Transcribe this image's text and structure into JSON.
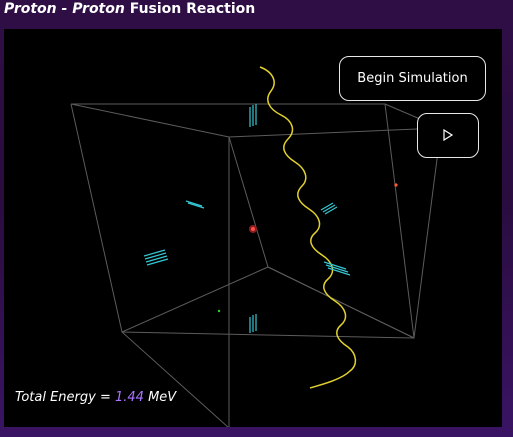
{
  "title": {
    "proton1": "Proton",
    "separator": " - ",
    "proton2": "Proton",
    "rest": " Fusion Reaction"
  },
  "controls": {
    "begin_label": "Begin Simulation",
    "play_icon": "play-icon"
  },
  "energy": {
    "label": "Total Energy = ",
    "value": "1.44",
    "unit": " MeV"
  },
  "scene": {
    "cube_color": "#666666",
    "photon_color": "#e1d12f",
    "particle_color": "#35c7d3",
    "accent_color": "#a974ff",
    "proton_color": "#ff4d4d",
    "electron_color": "#2bd12b"
  }
}
